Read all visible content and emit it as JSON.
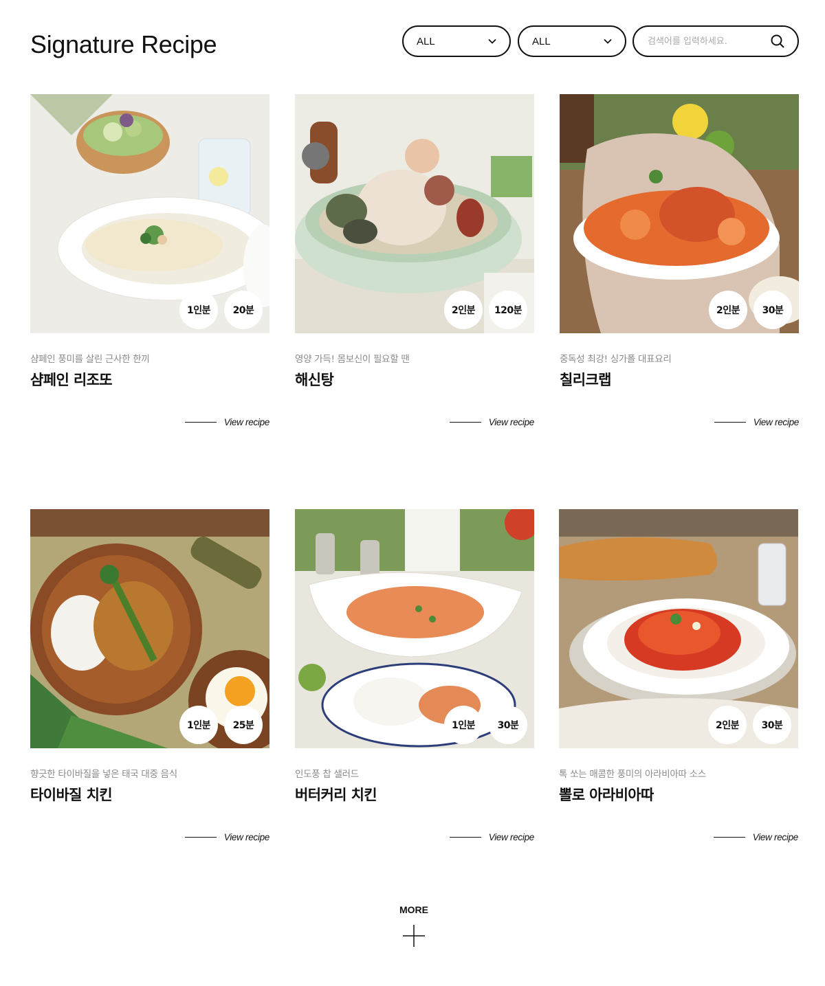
{
  "page": {
    "title": "Signature Recipe"
  },
  "filters": {
    "select1": {
      "value": "ALL"
    },
    "select2": {
      "value": "ALL"
    },
    "search": {
      "placeholder": "검색어를 입력하세요."
    }
  },
  "recipes": [
    {
      "servings": "1인분",
      "time": "20분",
      "subtitle": "샴페인 풍미를 살린 근사한 한끼",
      "title": "샴페인 리조또",
      "view_label": "View recipe",
      "image": "risotto-photo"
    },
    {
      "servings": "2인분",
      "time": "120분",
      "subtitle": "영양 가득! 몸보신이 필요할 땐",
      "title": "해신탕",
      "view_label": "View recipe",
      "image": "haesintang-photo"
    },
    {
      "servings": "2인분",
      "time": "30분",
      "subtitle": "중독성 최강! 싱가폴 대표요리",
      "title": "칠리크랩",
      "view_label": "View recipe",
      "image": "chili-crab-photo"
    },
    {
      "servings": "1인분",
      "time": "25분",
      "subtitle": "향긋한 타이바질을 넣은 태국 대중 음식",
      "title": "타이바질 치킨",
      "view_label": "View recipe",
      "image": "thai-basil-chicken-photo"
    },
    {
      "servings": "1인분",
      "time": "30분",
      "subtitle": "인도풍 찹 샐러드",
      "title": "버터커리 치킨",
      "view_label": "View recipe",
      "image": "butter-curry-chicken-photo"
    },
    {
      "servings": "2인분",
      "time": "30분",
      "subtitle": "톡 쏘는 매콤한 풍미의 아라비아따 소스",
      "title": "뽈로 아라비아따",
      "view_label": "View recipe",
      "image": "pollo-arrabbiata-photo"
    }
  ],
  "more": {
    "label": "MORE"
  }
}
